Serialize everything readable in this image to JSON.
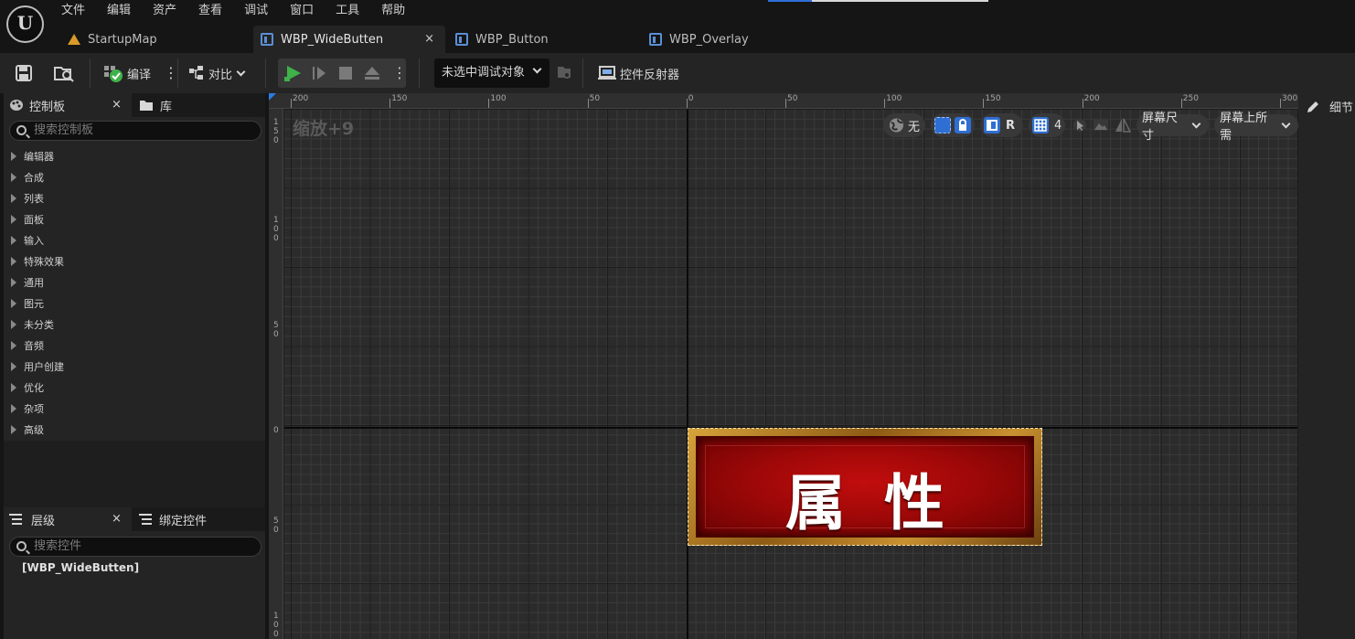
{
  "menu": [
    "文件",
    "编辑",
    "资产",
    "查看",
    "调试",
    "窗口",
    "工具",
    "帮助"
  ],
  "tabs": [
    {
      "label": "StartupMap",
      "icon": "map-icon"
    },
    {
      "label": "WBP_WideButten",
      "icon": "widget-blueprint-icon",
      "close": "×"
    },
    {
      "label": "WBP_Button",
      "icon": "widget-blueprint-icon"
    },
    {
      "label": "WBP_Overlay",
      "icon": "widget-blueprint-icon"
    }
  ],
  "toolbar": {
    "compile_label": "编译",
    "diff_label": "对比",
    "debug_select": "未选中调试对象",
    "reflector_label": "控件反射器"
  },
  "palette": {
    "tab_label": "控制板",
    "library_label": "库",
    "close": "×",
    "search_placeholder": "搜索控制板",
    "categories": [
      "编辑器",
      "合成",
      "列表",
      "面板",
      "输入",
      "特殊效果",
      "通用",
      "图元",
      "未分类",
      "音频",
      "用户创建",
      "优化",
      "杂项",
      "高级"
    ]
  },
  "hierarchy": {
    "tab_label": "层级",
    "bind_label": "绑定控件",
    "close": "×",
    "search_placeholder": "搜索控件",
    "root": "[WBP_WideButten]"
  },
  "designer": {
    "zoom": "缩放+9",
    "ruler_top": [
      "200",
      "150",
      "100",
      "50",
      "0",
      "50",
      "100",
      "150",
      "200",
      "250",
      "300"
    ],
    "ruler_left": [
      "150",
      "100",
      "50",
      "0",
      "50",
      "100"
    ],
    "tools": {
      "none_label": "无",
      "r_label": "R",
      "grid_value": "4",
      "screen_size": "屏幕尺寸",
      "fill_screen": "屏幕上所需"
    },
    "button_text": "属性"
  },
  "details": {
    "tab_label": "细节"
  },
  "colors": {
    "accent": "#2f6fd3",
    "play_green": "#3fb24a",
    "button_red": "#a00808",
    "button_gold": "#c89030"
  }
}
